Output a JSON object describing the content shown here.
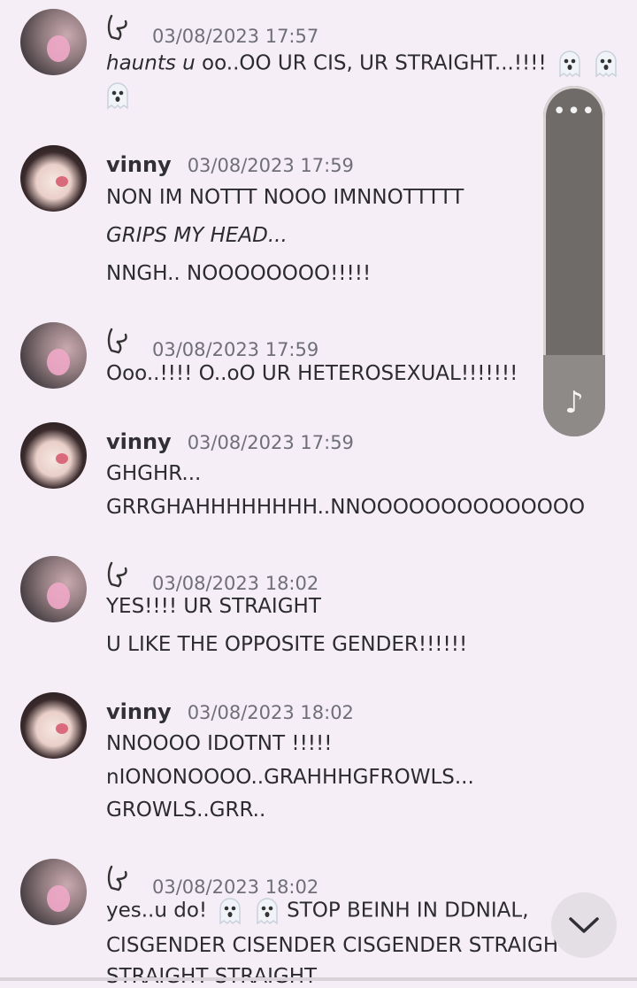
{
  "messages": [
    {
      "author_kind": "unnamed",
      "time": "03/08/2023 17:57",
      "line1_italic": "haunts u",
      "line1_rest": " oo..OO UR CIS, UR STRAIGHT...!!!!"
    },
    {
      "author": "vinny",
      "time": "03/08/2023 17:59",
      "lines": [
        "NON IM NOTTT NOOO IMNNOTTTTT",
        "GRIPS MY HEAD...",
        "NNGH.. NOOOOOOOO!!!!!"
      ]
    },
    {
      "author_kind": "unnamed",
      "time": "03/08/2023 17:59",
      "lines": [
        "Ooo..!!!! O..oO UR HETEROSEXUAL!!!!!!!"
      ]
    },
    {
      "author": "vinny",
      "time": "03/08/2023 17:59",
      "lines": [
        "GHGHR...",
        "GRRGHAHHHHHHHH..NNOOOOOOOOOOOOOO"
      ]
    },
    {
      "author_kind": "unnamed",
      "time": "03/08/2023 18:02",
      "lines": [
        "YES!!!! UR STRAIGHT",
        "U LIKE THE OPPOSITE GENDER!!!!!!"
      ]
    },
    {
      "author": "vinny",
      "time": "03/08/2023 18:02",
      "lines": [
        "NNOOOO IDOTNT !!!!!",
        "nIONONOOOO..GRAHHHGFROWLS...",
        "GROWLS..GRR.."
      ]
    },
    {
      "author_kind": "unnamed",
      "time": "03/08/2023 18:02",
      "line1_a": "yes..u do!",
      "line1_b": " STOP BEINH IN DDNIAL,",
      "lines": [
        "CISGENDER CISENDER CISGENDER STRAIGH",
        "STRAIGHT STRAIGHT"
      ]
    }
  ],
  "player": {
    "menu_dots": "•••",
    "note_glyph": "♪"
  },
  "icons": {
    "name_icon": "curly-name-icon",
    "ghost": "ghost-emoji",
    "jump": "chevron-down-icon"
  }
}
